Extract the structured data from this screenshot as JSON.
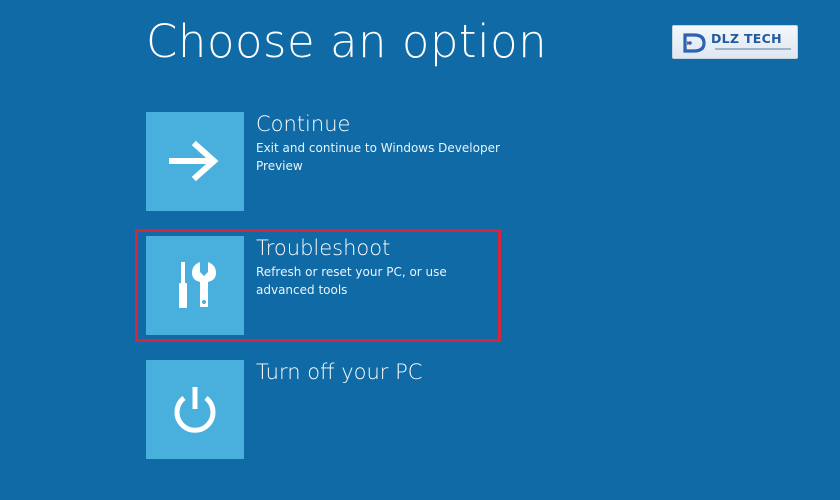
{
  "header": {
    "title": "Choose an option"
  },
  "logo": {
    "text": "DLZ TECH",
    "icon": "dlz-logo-icon"
  },
  "options": [
    {
      "title": "Continue",
      "description": "Exit and continue to Windows Developer Preview",
      "icon": "arrow-right-icon"
    },
    {
      "title": "Troubleshoot",
      "description": "Refresh or reset your PC, or use advanced tools",
      "icon": "tools-icon"
    },
    {
      "title": "Turn off your PC",
      "description": "",
      "icon": "power-icon"
    }
  ],
  "highlight": {
    "target": "option-troubleshoot",
    "color": "#d6263b"
  },
  "colors": {
    "background": "#0f6aa6",
    "tile": "#49afdc",
    "text": "#ffffff"
  }
}
